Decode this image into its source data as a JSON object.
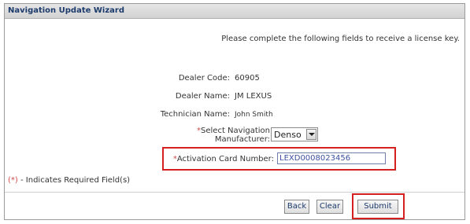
{
  "window": {
    "title": "Navigation Update Wizard"
  },
  "form": {
    "instructions": "Please complete the following fields to receive a license key.",
    "dealer_code": {
      "label": "Dealer Code:",
      "value": "60905"
    },
    "dealer_name": {
      "label": "Dealer Name:",
      "value": "JM LEXUS"
    },
    "technician_name": {
      "label": "Technician Name:",
      "value": "John Smith"
    },
    "navigation_manufacturer": {
      "required_mark": "*",
      "label_line1": "Select Navigation",
      "label_line2": "Manufacturer:",
      "selected": "Denso"
    },
    "activation_card": {
      "required_mark": "*",
      "label": "Activation Card Number:",
      "value": "LEXD0008023456"
    },
    "required_note": {
      "mark": "(*)",
      "text": " - Indicates Required Field(s)"
    }
  },
  "buttons": {
    "back": "Back",
    "clear": "Clear",
    "submit": "Submit"
  },
  "colors": {
    "highlight": "#d42020",
    "required": "#d04a4a",
    "title": "#1c3a6b"
  }
}
